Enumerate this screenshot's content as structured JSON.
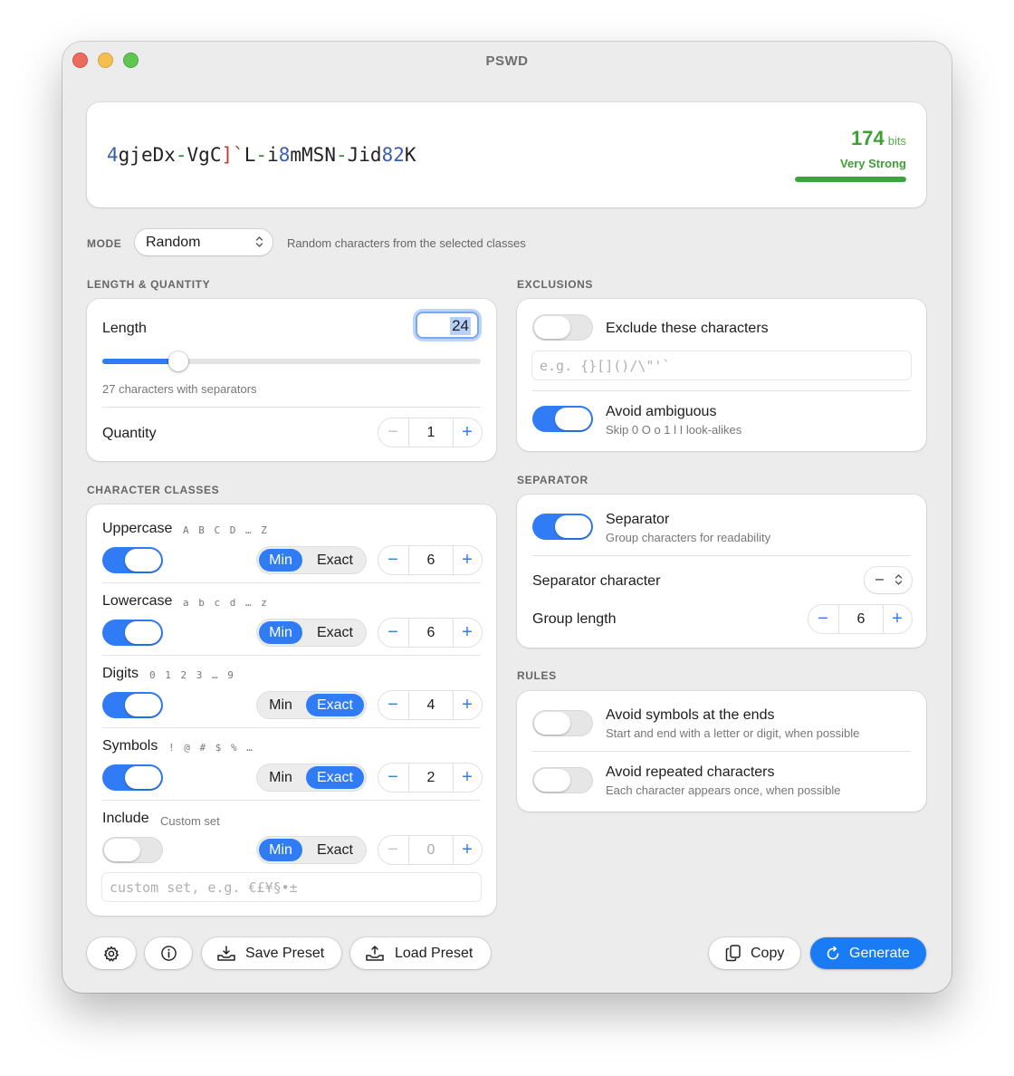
{
  "window": {
    "title": "PSWD"
  },
  "password": {
    "segments": [
      {
        "t": "4",
        "k": "dig"
      },
      {
        "t": "gjeDx",
        "k": "ch"
      },
      {
        "t": "-",
        "k": "sep"
      },
      {
        "t": "VgC",
        "k": "ch"
      },
      {
        "t": "]`",
        "k": "sym"
      },
      {
        "t": "L",
        "k": "ch"
      },
      {
        "t": "-",
        "k": "sep"
      },
      {
        "t": "i",
        "k": "ch"
      },
      {
        "t": "8",
        "k": "dig"
      },
      {
        "t": "mMSN",
        "k": "ch"
      },
      {
        "t": "-",
        "k": "sep"
      },
      {
        "t": "Jid",
        "k": "ch"
      },
      {
        "t": "82",
        "k": "dig"
      },
      {
        "t": "K",
        "k": "ch"
      }
    ],
    "bits": "174",
    "bits_unit": "bits",
    "strength": "Very Strong",
    "strength_fraction": 1.0,
    "strength_color": "#3aa53c"
  },
  "mode": {
    "label": "MODE",
    "value": "Random",
    "description": "Random characters from the selected classes"
  },
  "length_quantity": {
    "section": "LENGTH & QUANTITY",
    "length_label": "Length",
    "length_value": "24",
    "slider_fraction": 0.2,
    "length_note": "27 characters with separators",
    "quantity_label": "Quantity",
    "quantity_value": "1"
  },
  "character_classes": {
    "section": "CHARACTER CLASSES",
    "min_label": "Min",
    "exact_label": "Exact",
    "items": [
      {
        "name": "Uppercase",
        "sample": "A B C D … Z",
        "enabled": true,
        "mode": "Min",
        "value": "6"
      },
      {
        "name": "Lowercase",
        "sample": "a b c d … z",
        "enabled": true,
        "mode": "Min",
        "value": "6"
      },
      {
        "name": "Digits",
        "sample": "0 1 2 3 … 9",
        "enabled": true,
        "mode": "Exact",
        "value": "4"
      },
      {
        "name": "Symbols",
        "sample": "! @ # $ % …",
        "enabled": true,
        "mode": "Exact",
        "value": "2"
      },
      {
        "name": "Include",
        "sample": "Custom set",
        "enabled": false,
        "mode": "Min",
        "value": "0"
      }
    ],
    "custom_placeholder": "custom set, e.g. €£¥§•±"
  },
  "exclusions": {
    "section": "EXCLUSIONS",
    "exclude_label": "Exclude these characters",
    "exclude_enabled": false,
    "exclude_placeholder": "e.g. {}[]()/\\\"'`",
    "ambiguous_label": "Avoid ambiguous",
    "ambiguous_sub": "Skip 0 O o 1 l I look-alikes",
    "ambiguous_enabled": true
  },
  "separator": {
    "section": "SEPARATOR",
    "label": "Separator",
    "sub": "Group characters for readability",
    "enabled": true,
    "char_label": "Separator character",
    "char_value": "–",
    "group_label": "Group length",
    "group_value": "6"
  },
  "rules": {
    "section": "RULES",
    "items": [
      {
        "label": "Avoid symbols at the ends",
        "sub": "Start and end with a letter or digit, when possible",
        "enabled": false
      },
      {
        "label": "Avoid repeated characters",
        "sub": "Each character appears once, when possible",
        "enabled": false
      }
    ]
  },
  "toolbar": {
    "settings_icon": "gear-icon",
    "info_icon": "info-icon",
    "save_label": "Save Preset",
    "load_label": "Load Preset",
    "copy_label": "Copy",
    "generate_label": "Generate",
    "accent": "#1a7cf5"
  }
}
